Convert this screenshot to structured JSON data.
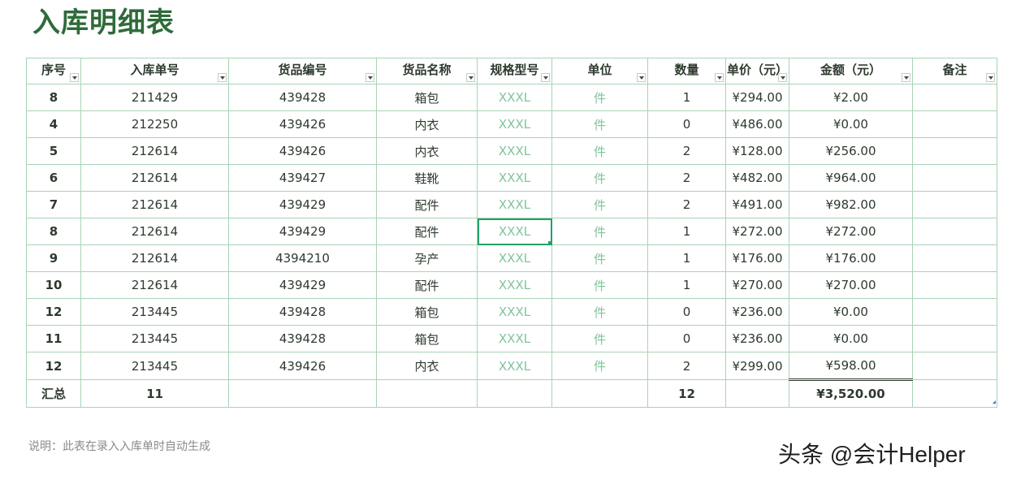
{
  "title": "入库明细表",
  "headers": [
    "序号",
    "入库单号",
    "货品编号",
    "货品名称",
    "规格型号",
    "单位",
    "数量",
    "单价（元）",
    "金额（元）",
    "备注"
  ],
  "rows": [
    {
      "seq": "8",
      "order": "211429",
      "code": "439428",
      "name": "箱包",
      "spec": "XXXL",
      "unit": "件",
      "qty": "1",
      "price": "¥294.00",
      "amount": "¥2.00",
      "note": ""
    },
    {
      "seq": "4",
      "order": "212250",
      "code": "439426",
      "name": "内衣",
      "spec": "XXXL",
      "unit": "件",
      "qty": "0",
      "price": "¥486.00",
      "amount": "¥0.00",
      "note": ""
    },
    {
      "seq": "5",
      "order": "212614",
      "code": "439426",
      "name": "内衣",
      "spec": "XXXL",
      "unit": "件",
      "qty": "2",
      "price": "¥128.00",
      "amount": "¥256.00",
      "note": ""
    },
    {
      "seq": "6",
      "order": "212614",
      "code": "439427",
      "name": "鞋靴",
      "spec": "XXXL",
      "unit": "件",
      "qty": "2",
      "price": "¥482.00",
      "amount": "¥964.00",
      "note": ""
    },
    {
      "seq": "7",
      "order": "212614",
      "code": "439429",
      "name": "配件",
      "spec": "XXXL",
      "unit": "件",
      "qty": "2",
      "price": "¥491.00",
      "amount": "¥982.00",
      "note": ""
    },
    {
      "seq": "8",
      "order": "212614",
      "code": "439429",
      "name": "配件",
      "spec": "XXXL",
      "unit": "件",
      "qty": "1",
      "price": "¥272.00",
      "amount": "¥272.00",
      "note": ""
    },
    {
      "seq": "9",
      "order": "212614",
      "code": "4394210",
      "name": "孕产",
      "spec": "XXXL",
      "unit": "件",
      "qty": "1",
      "price": "¥176.00",
      "amount": "¥176.00",
      "note": ""
    },
    {
      "seq": "10",
      "order": "212614",
      "code": "439429",
      "name": "配件",
      "spec": "XXXL",
      "unit": "件",
      "qty": "1",
      "price": "¥270.00",
      "amount": "¥270.00",
      "note": ""
    },
    {
      "seq": "12",
      "order": "213445",
      "code": "439428",
      "name": "箱包",
      "spec": "XXXL",
      "unit": "件",
      "qty": "0",
      "price": "¥236.00",
      "amount": "¥0.00",
      "note": ""
    },
    {
      "seq": "11",
      "order": "213445",
      "code": "439428",
      "name": "箱包",
      "spec": "XXXL",
      "unit": "件",
      "qty": "0",
      "price": "¥236.00",
      "amount": "¥0.00",
      "note": ""
    },
    {
      "seq": "12",
      "order": "213445",
      "code": "439426",
      "name": "内衣",
      "spec": "XXXL",
      "unit": "件",
      "qty": "2",
      "price": "¥299.00",
      "amount": "¥598.00",
      "note": ""
    }
  ],
  "total": {
    "label": "汇总",
    "count": "11",
    "qty": "12",
    "amount": "¥3,520.00"
  },
  "note": "说明：此表在录入入库单时自动生成",
  "watermark": "头条 @会计Helper",
  "selected_row": 5,
  "selected_col": "spec"
}
